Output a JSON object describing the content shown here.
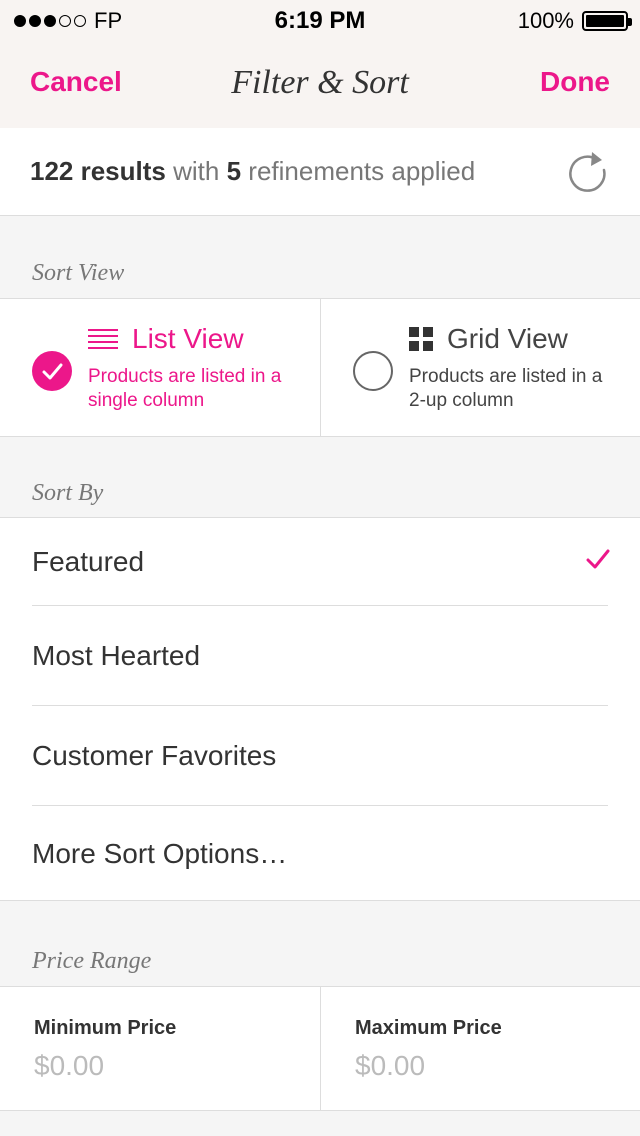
{
  "status_bar": {
    "carrier": "FP",
    "signal_bars": 3,
    "signal_total": 5,
    "time": "6:19 PM",
    "battery": "100%",
    "battery_level": 1.0
  },
  "nav": {
    "cancel_label": "Cancel",
    "title": "Filter & Sort",
    "done_label": "Done"
  },
  "results": {
    "count": "122 results",
    "with": "with",
    "refinements_count": "5",
    "refinements_text": "refinements applied",
    "refresh_icon": "refresh-icon"
  },
  "sort_view": {
    "label": "Sort View",
    "options": [
      {
        "title": "List View",
        "desc": "Products are listed in a single column",
        "icon": "list-icon",
        "selected": true
      },
      {
        "title": "Grid View",
        "desc": "Products are listed in a 2-up column",
        "icon": "grid-icon",
        "selected": false
      }
    ]
  },
  "sort_by": {
    "label": "Sort By",
    "items": [
      {
        "label": "Featured",
        "selected": true
      },
      {
        "label": "Most Hearted",
        "selected": false
      },
      {
        "label": "Customer Favorites",
        "selected": false
      },
      {
        "label": "More Sort Options…",
        "selected": false
      }
    ]
  },
  "price_range": {
    "label": "Price Range",
    "min_label": "Minimum Price",
    "min_placeholder": "$0.00",
    "max_label": "Maximum Price",
    "max_placeholder": "$0.00"
  },
  "colors": {
    "accent": "#ec178a",
    "header_bg": "#f8f4f2",
    "section_bg": "#f5f5f5"
  }
}
